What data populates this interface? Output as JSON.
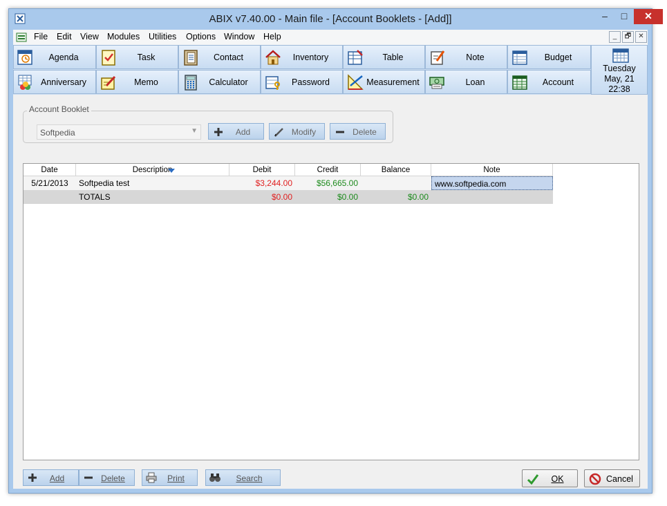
{
  "window": {
    "title": "ABIX v7.40.00  -  Main file - [Account Booklets  -  [Add]]",
    "min_glyph": "‒",
    "max_glyph": "□",
    "close_glyph": "✕"
  },
  "menu": {
    "items": [
      "File",
      "Edit",
      "View",
      "Modules",
      "Utilities",
      "Options",
      "Window",
      "Help"
    ],
    "mdi": [
      "_",
      "🗗",
      "✕"
    ]
  },
  "toolbar": {
    "row1": [
      {
        "label": "Agenda",
        "icon": "agenda-icon"
      },
      {
        "label": "Task",
        "icon": "task-icon"
      },
      {
        "label": "Contact",
        "icon": "contact-icon"
      },
      {
        "label": "Inventory",
        "icon": "inventory-icon"
      },
      {
        "label": "Table",
        "icon": "table-icon"
      },
      {
        "label": "Note",
        "icon": "note-icon"
      },
      {
        "label": "Budget",
        "icon": "budget-icon"
      }
    ],
    "row2": [
      {
        "label": "Anniversary",
        "icon": "anniversary-icon"
      },
      {
        "label": "Memo",
        "icon": "memo-icon"
      },
      {
        "label": "Calculator",
        "icon": "calculator-icon"
      },
      {
        "label": "Password",
        "icon": "password-icon"
      },
      {
        "label": "Measurement",
        "icon": "measurement-icon"
      },
      {
        "label": "Loan",
        "icon": "loan-icon"
      },
      {
        "label": "Account",
        "icon": "account-icon"
      }
    ],
    "date": {
      "day": "Tuesday",
      "date": "May, 21",
      "time": "22:38"
    }
  },
  "account_booklet": {
    "group_label": "Account Booklet",
    "selected": "Softpedia",
    "add_label": "Add",
    "modify_label": "Modify",
    "delete_label": "Delete"
  },
  "grid": {
    "columns": [
      "Date",
      "Description",
      "Debit",
      "Credit",
      "Balance",
      "Note"
    ],
    "rows": [
      {
        "date": "5/21/2013",
        "description": "Softpedia test",
        "debit": "$3,244.00",
        "credit": "$56,665.00",
        "balance": "",
        "note": "www.softpedia.com"
      }
    ],
    "totals": {
      "label": "TOTALS",
      "debit": "$0.00",
      "credit": "$0.00",
      "balance": "$0.00"
    },
    "colors": {
      "debit": "#e02020",
      "credit": "#1c8a1c"
    }
  },
  "bottom": {
    "add_label": "Add",
    "delete_label": "Delete",
    "print_label": "Print",
    "search_label": "Search",
    "ok_label": "OK",
    "cancel_label": "Cancel"
  }
}
